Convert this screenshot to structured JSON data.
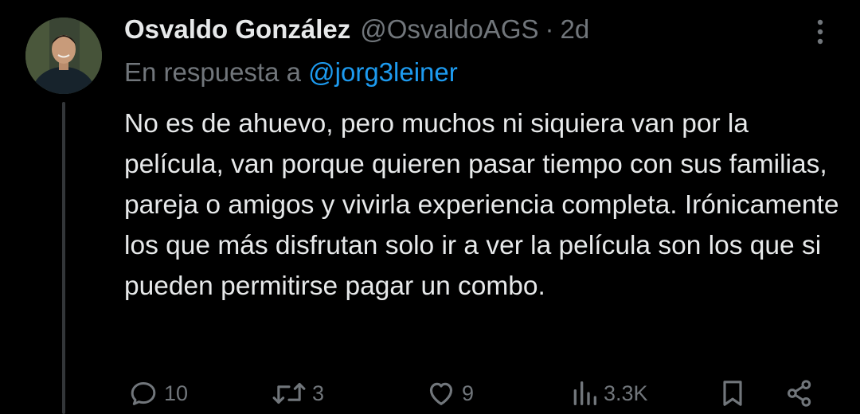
{
  "tweet": {
    "author_name": "Osvaldo González",
    "handle": "@OsvaldoAGS",
    "separator": "·",
    "time": "2d",
    "reply_prefix": "En respuesta a",
    "reply_mention": "@jorg3leiner",
    "text": "No es de ahuevo, pero muchos ni siquiera van por la película, van porque quieren pasar tiempo con sus familias, pareja o amigos y vivirla experiencia completa. Irónicamente los que más disfrutan solo ir a ver la película son los que si pueden permitirse pagar un combo."
  },
  "actions": {
    "replies": "10",
    "retweets": "3",
    "likes": "9",
    "views": "3.3K"
  },
  "icons": {
    "reply": "reply-icon",
    "retweet": "retweet-icon",
    "like": "heart-icon",
    "views": "views-icon",
    "bookmark": "bookmark-icon",
    "share": "share-icon",
    "more": "more-icon"
  },
  "colors": {
    "background": "#000000",
    "text": "#e7e9ea",
    "muted": "#71767b",
    "link": "#1d9bf0"
  }
}
